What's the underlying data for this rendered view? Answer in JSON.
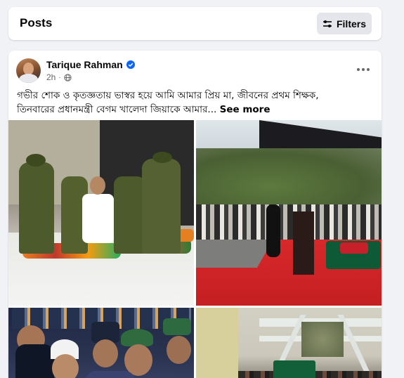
{
  "header": {
    "title": "Posts",
    "filters_label": "Filters"
  },
  "post": {
    "author": "Tarique Rahman",
    "verified": true,
    "time": "2h",
    "privacy_icon": "globe-icon",
    "caption_line1": "গভীর শোক ও কৃতজ্ঞতায় ভাস্বর হয়ে আমি আমার প্রিয় মা, জীবনের প্রথম শিক্ষক,",
    "caption_line2": "তিনবারের প্রধানমন্ত্রী বেগম খালেদা জিয়াকে আমার...",
    "see_more": "See more"
  },
  "colors": {
    "background": "#f0f2f5",
    "card": "#ffffff",
    "verified_blue": "#0866ff",
    "secondary_text": "#65676b"
  }
}
